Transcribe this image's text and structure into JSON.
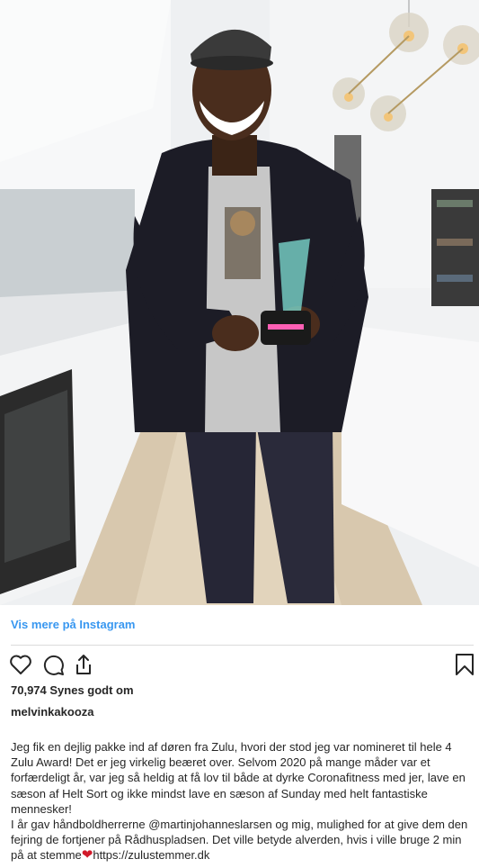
{
  "post": {
    "view_more": "Vis mere på Instagram",
    "likes": "70,974 Synes godt om",
    "username": "melvinkakooza",
    "caption": {
      "para1": "Jeg fik en dejlig pakke ind af døren fra Zulu, hvori der stod jeg var nomineret til hele 4 Zulu Award! Det er jeg virkelig beæret over. Selvom 2020 på mange måder var et forfærdeligt år, var jeg så heldig at få lov til både at dyrke Coronafitness med jer, lave en sæson af Helt Sort og ikke mindst lave en sæson af Sunday med helt fantastiske mennesker!",
      "para2_before": "I år gav håndboldherrerne @martinjohanneslarsen og mig, mulighed for at give dem den fejring de fortjener på Rådhuspladsen. Det ville betyde alverden, hvis i ville bruge 2 min på at stemme",
      "heart": "❤",
      "para2_after": "https://zulustemmer.dk"
    }
  },
  "icons": {
    "like": "heart-outline-icon",
    "comment": "comment-icon",
    "share": "share-icon",
    "save": "bookmark-icon"
  },
  "colors": {
    "link": "#3897f0",
    "text": "#262626",
    "divider": "#dbdbdb",
    "heart": "#d11a2a"
  }
}
